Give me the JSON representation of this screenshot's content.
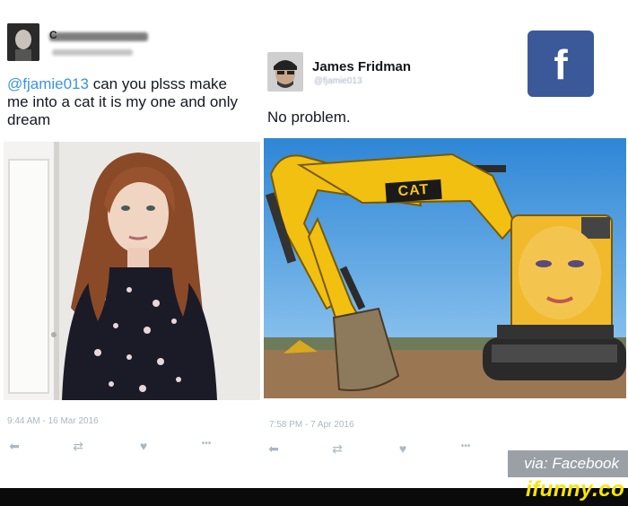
{
  "left_tweet": {
    "username_blurred": "C",
    "mention": "@fjamie013",
    "text": " can you plsss make me into a cat it is my one and only dream",
    "timestamp": "9:44 AM - 16 Mar 2016"
  },
  "right_tweet": {
    "name": "James Fridman",
    "handle": "@fjamie013",
    "text": "No problem.",
    "timestamp": "7:58 PM - 7 Apr 2016",
    "cat_logo": "CAT"
  },
  "actions": {
    "reply": "⬅",
    "retweet": "⇄",
    "like": "♥",
    "more": "•••"
  },
  "facebook": {
    "logo_letter": "f"
  },
  "watermarks": {
    "via": "via: Facebook",
    "site": "ifunny.co"
  },
  "colors": {
    "facebook_blue": "#3b5998",
    "cat_yellow": "#f2c011",
    "sky_blue": "#3e97dc",
    "mention_blue": "#3b94d9",
    "ifunny_yellow": "#f7e600"
  }
}
